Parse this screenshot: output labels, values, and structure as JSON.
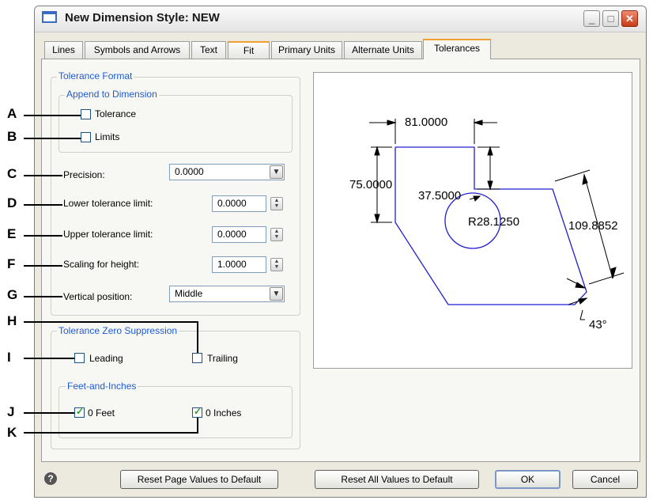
{
  "window": {
    "title": "New Dimension Style: NEW"
  },
  "tabs": [
    {
      "label": "Lines"
    },
    {
      "label": "Symbols and Arrows"
    },
    {
      "label": "Text"
    },
    {
      "label": "Fit"
    },
    {
      "label": "Primary Units"
    },
    {
      "label": "Alternate Units"
    },
    {
      "label": "Tolerances"
    }
  ],
  "tolerance_format": {
    "legend": "Tolerance Format",
    "append_legend": "Append to Dimension",
    "tolerance_label": "Tolerance",
    "tolerance_checked": false,
    "limits_label": "Limits",
    "limits_checked": false,
    "precision_label": "Precision:",
    "precision_value": "0.0000",
    "lower_label": "Lower tolerance limit:",
    "lower_value": "0.0000",
    "upper_label": "Upper tolerance limit:",
    "upper_value": "0.0000",
    "scaling_label": "Scaling for height:",
    "scaling_value": "1.0000",
    "vertical_label": "Vertical position:",
    "vertical_value": "Middle"
  },
  "zero_suppression": {
    "legend": "Tolerance Zero Suppression",
    "leading_label": "Leading",
    "leading_checked": false,
    "trailing_label": "Trailing",
    "trailing_checked": false,
    "feet_inches_legend": "Feet-and-Inches",
    "feet_label": "0 Feet",
    "feet_checked": true,
    "inches_label": "0 Inches",
    "inches_checked": true
  },
  "preview": {
    "dim_top": "81.0000",
    "dim_left": "75.0000",
    "dim_inner": "37.5000",
    "dim_radius": "R28.1250",
    "dim_right": "109.8852",
    "dim_angle": "43°"
  },
  "buttons": {
    "reset_page": "Reset Page Values to Default",
    "reset_all": "Reset All Values to Default",
    "ok": "OK",
    "cancel": "Cancel"
  },
  "callouts": [
    "A",
    "B",
    "C",
    "D",
    "E",
    "F",
    "G",
    "H",
    "I",
    "J",
    "K"
  ],
  "icons": [
    "app-window-icon",
    "minimize-icon",
    "maximize-icon",
    "close-icon",
    "chevron-down-icon",
    "spin-up-down-icon",
    "help-icon",
    "checkmark-icon"
  ]
}
